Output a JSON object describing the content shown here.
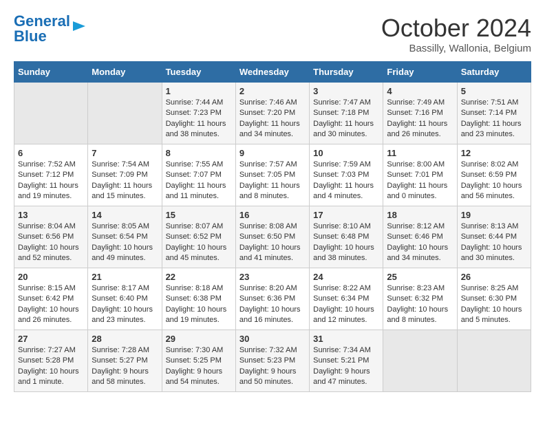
{
  "logo": {
    "part1": "General",
    "part2": "Blue"
  },
  "title": "October 2024",
  "subtitle": "Bassilly, Wallonia, Belgium",
  "headers": [
    "Sunday",
    "Monday",
    "Tuesday",
    "Wednesday",
    "Thursday",
    "Friday",
    "Saturday"
  ],
  "weeks": [
    [
      {
        "day": "",
        "sunrise": "",
        "sunset": "",
        "daylight": ""
      },
      {
        "day": "",
        "sunrise": "",
        "sunset": "",
        "daylight": ""
      },
      {
        "day": "1",
        "sunrise": "Sunrise: 7:44 AM",
        "sunset": "Sunset: 7:23 PM",
        "daylight": "Daylight: 11 hours and 38 minutes."
      },
      {
        "day": "2",
        "sunrise": "Sunrise: 7:46 AM",
        "sunset": "Sunset: 7:20 PM",
        "daylight": "Daylight: 11 hours and 34 minutes."
      },
      {
        "day": "3",
        "sunrise": "Sunrise: 7:47 AM",
        "sunset": "Sunset: 7:18 PM",
        "daylight": "Daylight: 11 hours and 30 minutes."
      },
      {
        "day": "4",
        "sunrise": "Sunrise: 7:49 AM",
        "sunset": "Sunset: 7:16 PM",
        "daylight": "Daylight: 11 hours and 26 minutes."
      },
      {
        "day": "5",
        "sunrise": "Sunrise: 7:51 AM",
        "sunset": "Sunset: 7:14 PM",
        "daylight": "Daylight: 11 hours and 23 minutes."
      }
    ],
    [
      {
        "day": "6",
        "sunrise": "Sunrise: 7:52 AM",
        "sunset": "Sunset: 7:12 PM",
        "daylight": "Daylight: 11 hours and 19 minutes."
      },
      {
        "day": "7",
        "sunrise": "Sunrise: 7:54 AM",
        "sunset": "Sunset: 7:09 PM",
        "daylight": "Daylight: 11 hours and 15 minutes."
      },
      {
        "day": "8",
        "sunrise": "Sunrise: 7:55 AM",
        "sunset": "Sunset: 7:07 PM",
        "daylight": "Daylight: 11 hours and 11 minutes."
      },
      {
        "day": "9",
        "sunrise": "Sunrise: 7:57 AM",
        "sunset": "Sunset: 7:05 PM",
        "daylight": "Daylight: 11 hours and 8 minutes."
      },
      {
        "day": "10",
        "sunrise": "Sunrise: 7:59 AM",
        "sunset": "Sunset: 7:03 PM",
        "daylight": "Daylight: 11 hours and 4 minutes."
      },
      {
        "day": "11",
        "sunrise": "Sunrise: 8:00 AM",
        "sunset": "Sunset: 7:01 PM",
        "daylight": "Daylight: 11 hours and 0 minutes."
      },
      {
        "day": "12",
        "sunrise": "Sunrise: 8:02 AM",
        "sunset": "Sunset: 6:59 PM",
        "daylight": "Daylight: 10 hours and 56 minutes."
      }
    ],
    [
      {
        "day": "13",
        "sunrise": "Sunrise: 8:04 AM",
        "sunset": "Sunset: 6:56 PM",
        "daylight": "Daylight: 10 hours and 52 minutes."
      },
      {
        "day": "14",
        "sunrise": "Sunrise: 8:05 AM",
        "sunset": "Sunset: 6:54 PM",
        "daylight": "Daylight: 10 hours and 49 minutes."
      },
      {
        "day": "15",
        "sunrise": "Sunrise: 8:07 AM",
        "sunset": "Sunset: 6:52 PM",
        "daylight": "Daylight: 10 hours and 45 minutes."
      },
      {
        "day": "16",
        "sunrise": "Sunrise: 8:08 AM",
        "sunset": "Sunset: 6:50 PM",
        "daylight": "Daylight: 10 hours and 41 minutes."
      },
      {
        "day": "17",
        "sunrise": "Sunrise: 8:10 AM",
        "sunset": "Sunset: 6:48 PM",
        "daylight": "Daylight: 10 hours and 38 minutes."
      },
      {
        "day": "18",
        "sunrise": "Sunrise: 8:12 AM",
        "sunset": "Sunset: 6:46 PM",
        "daylight": "Daylight: 10 hours and 34 minutes."
      },
      {
        "day": "19",
        "sunrise": "Sunrise: 8:13 AM",
        "sunset": "Sunset: 6:44 PM",
        "daylight": "Daylight: 10 hours and 30 minutes."
      }
    ],
    [
      {
        "day": "20",
        "sunrise": "Sunrise: 8:15 AM",
        "sunset": "Sunset: 6:42 PM",
        "daylight": "Daylight: 10 hours and 26 minutes."
      },
      {
        "day": "21",
        "sunrise": "Sunrise: 8:17 AM",
        "sunset": "Sunset: 6:40 PM",
        "daylight": "Daylight: 10 hours and 23 minutes."
      },
      {
        "day": "22",
        "sunrise": "Sunrise: 8:18 AM",
        "sunset": "Sunset: 6:38 PM",
        "daylight": "Daylight: 10 hours and 19 minutes."
      },
      {
        "day": "23",
        "sunrise": "Sunrise: 8:20 AM",
        "sunset": "Sunset: 6:36 PM",
        "daylight": "Daylight: 10 hours and 16 minutes."
      },
      {
        "day": "24",
        "sunrise": "Sunrise: 8:22 AM",
        "sunset": "Sunset: 6:34 PM",
        "daylight": "Daylight: 10 hours and 12 minutes."
      },
      {
        "day": "25",
        "sunrise": "Sunrise: 8:23 AM",
        "sunset": "Sunset: 6:32 PM",
        "daylight": "Daylight: 10 hours and 8 minutes."
      },
      {
        "day": "26",
        "sunrise": "Sunrise: 8:25 AM",
        "sunset": "Sunset: 6:30 PM",
        "daylight": "Daylight: 10 hours and 5 minutes."
      }
    ],
    [
      {
        "day": "27",
        "sunrise": "Sunrise: 7:27 AM",
        "sunset": "Sunset: 5:28 PM",
        "daylight": "Daylight: 10 hours and 1 minute."
      },
      {
        "day": "28",
        "sunrise": "Sunrise: 7:28 AM",
        "sunset": "Sunset: 5:27 PM",
        "daylight": "Daylight: 9 hours and 58 minutes."
      },
      {
        "day": "29",
        "sunrise": "Sunrise: 7:30 AM",
        "sunset": "Sunset: 5:25 PM",
        "daylight": "Daylight: 9 hours and 54 minutes."
      },
      {
        "day": "30",
        "sunrise": "Sunrise: 7:32 AM",
        "sunset": "Sunset: 5:23 PM",
        "daylight": "Daylight: 9 hours and 50 minutes."
      },
      {
        "day": "31",
        "sunrise": "Sunrise: 7:34 AM",
        "sunset": "Sunset: 5:21 PM",
        "daylight": "Daylight: 9 hours and 47 minutes."
      },
      {
        "day": "",
        "sunrise": "",
        "sunset": "",
        "daylight": ""
      },
      {
        "day": "",
        "sunrise": "",
        "sunset": "",
        "daylight": ""
      }
    ]
  ]
}
